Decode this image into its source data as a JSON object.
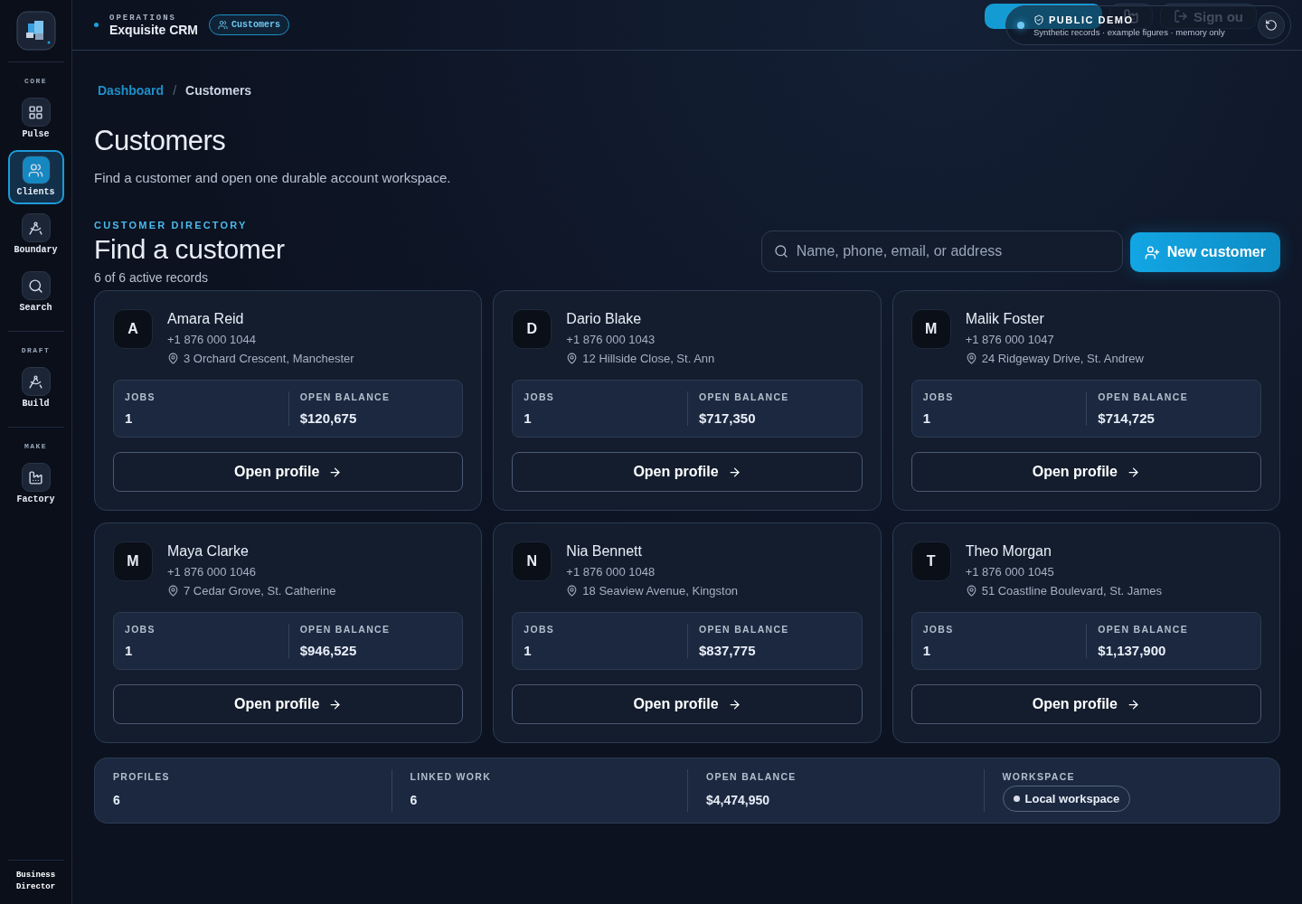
{
  "sidebar": {
    "sections": [
      {
        "title": "CORE",
        "items": [
          {
            "label": "Pulse",
            "selected": false
          },
          {
            "label": "Clients",
            "selected": true
          },
          {
            "label": "Boundary",
            "selected": false
          },
          {
            "label": "Search",
            "selected": false
          }
        ]
      },
      {
        "title": "DRAFT",
        "items": [
          {
            "label": "Build",
            "selected": false
          }
        ]
      },
      {
        "title": "MAKE",
        "items": [
          {
            "label": "Factory",
            "selected": false
          }
        ]
      }
    ],
    "footer": "Business Director"
  },
  "topbar": {
    "eyebrow": "OPERATIONS",
    "title": "Exquisite CRM",
    "chip": "Customers",
    "sign_out": "Sign ou",
    "demo": {
      "title": "PUBLIC DEMO",
      "subtitle": "Synthetic records · example figures · memory only"
    }
  },
  "breadcrumb": {
    "separator": "/",
    "items": [
      {
        "label": "Dashboard",
        "kind": "link"
      },
      {
        "label": "Customers",
        "kind": "current"
      }
    ]
  },
  "page": {
    "title": "Customers",
    "subtitle": "Find a customer and open one durable account workspace."
  },
  "directory": {
    "eyebrow": "CUSTOMER DIRECTORY",
    "title": "Find a customer",
    "count": "6 of 6 active records",
    "search": {
      "placeholder": "Name, phone, email, or address"
    },
    "new_button": "New customer"
  },
  "customers": [
    {
      "initial": "A",
      "name": "Amara Reid",
      "phone": "+1 876 000 1044",
      "address": "3 Orchard Crescent, Manchester",
      "jobs_label": "JOBS",
      "jobs": "1",
      "balance_label": "OPEN BALANCE",
      "balance": "$120,675",
      "action": "Open profile"
    },
    {
      "initial": "D",
      "name": "Dario Blake",
      "phone": "+1 876 000 1043",
      "address": "12 Hillside Close, St. Ann",
      "jobs_label": "JOBS",
      "jobs": "1",
      "balance_label": "OPEN BALANCE",
      "balance": "$717,350",
      "action": "Open profile"
    },
    {
      "initial": "M",
      "name": "Malik Foster",
      "phone": "+1 876 000 1047",
      "address": "24 Ridgeway Drive, St. Andrew",
      "jobs_label": "JOBS",
      "jobs": "1",
      "balance_label": "OPEN BALANCE",
      "balance": "$714,725",
      "action": "Open profile"
    },
    {
      "initial": "M",
      "name": "Maya Clarke",
      "phone": "+1 876 000 1046",
      "address": "7 Cedar Grove, St. Catherine",
      "jobs_label": "JOBS",
      "jobs": "1",
      "balance_label": "OPEN BALANCE",
      "balance": "$946,525",
      "action": "Open profile"
    },
    {
      "initial": "N",
      "name": "Nia Bennett",
      "phone": "+1 876 000 1048",
      "address": "18 Seaview Avenue, Kingston",
      "jobs_label": "JOBS",
      "jobs": "1",
      "balance_label": "OPEN BALANCE",
      "balance": "$837,775",
      "action": "Open profile"
    },
    {
      "initial": "T",
      "name": "Theo Morgan",
      "phone": "+1 876 000 1045",
      "address": "51 Coastline Boulevard, St. James",
      "jobs_label": "JOBS",
      "jobs": "1",
      "balance_label": "OPEN BALANCE",
      "balance": "$1,137,900",
      "action": "Open profile"
    }
  ],
  "summary": [
    {
      "label": "PROFILES",
      "value": "6",
      "kind": "number"
    },
    {
      "label": "LINKED WORK",
      "value": "6",
      "kind": "number"
    },
    {
      "label": "OPEN BALANCE",
      "value": "$4,474,950",
      "kind": "number"
    },
    {
      "label": "WORKSPACE",
      "value": "Local workspace",
      "kind": "pill"
    }
  ]
}
